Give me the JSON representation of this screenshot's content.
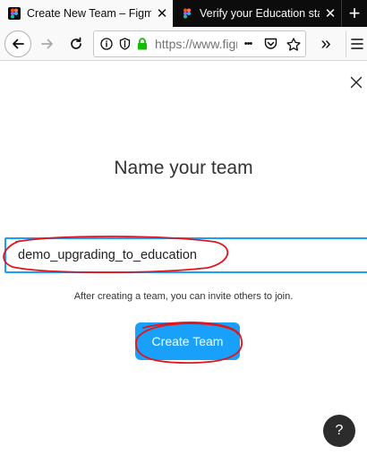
{
  "browser": {
    "tabs": [
      {
        "title": "Create New Team – Figma",
        "active": true,
        "close_glyph": "✕"
      },
      {
        "title": "Verify your Education status",
        "active": false,
        "close_glyph": "✕"
      }
    ],
    "new_tab_glyph": "+",
    "url": "https://www.figma.com/files/team/new",
    "icons": {
      "back": "arrow-left-icon",
      "forward": "arrow-right-icon",
      "reload": "reload-icon",
      "info": "info-icon",
      "tracking": "shield-icon",
      "lock": "lock-icon",
      "page_actions": "more-horizontal-icon",
      "pocket": "pocket-icon",
      "bookmark": "star-icon",
      "overflow": "chevron-double-right-icon",
      "menu": "hamburger-menu-icon"
    },
    "page_actions_glyph": "•••",
    "overflow_glyph": "»"
  },
  "dialog": {
    "close_glyph": "✕",
    "heading": "Name your team",
    "team_name_value": "demo_upgrading_to_education",
    "hint": "After creating a team, you can invite others to join.",
    "create_button_label": "Create Team",
    "help_label": "?"
  },
  "colors": {
    "accent": "#18a0fb",
    "annotation": "#e0161f",
    "lock_green": "#12bc00",
    "help_bg": "#2c2c2c"
  }
}
